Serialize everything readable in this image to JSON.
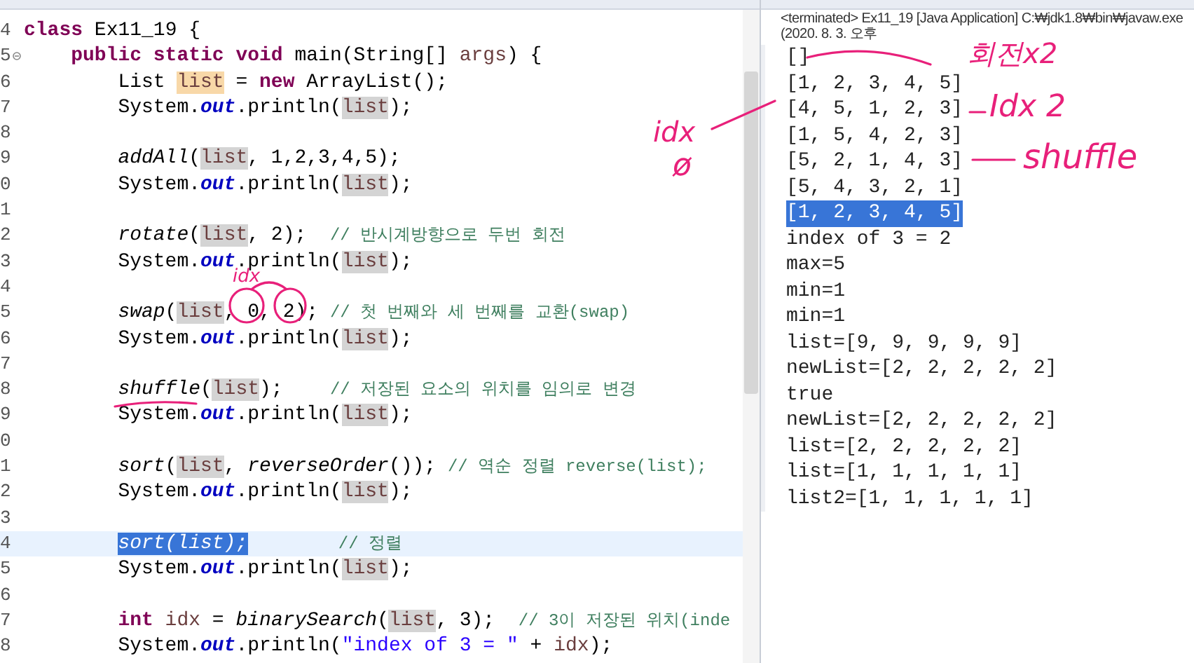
{
  "editor": {
    "lines": [
      {
        "number": "4",
        "current": false,
        "fold": false,
        "segments": [
          {
            "kind": "kw",
            "text": "class "
          },
          {
            "kind": "plain",
            "text": "Ex11_19 {"
          }
        ],
        "children": [
          {
            "number": "5",
            "current": false,
            "fold": true,
            "segments": [
              {
                "kind": "kw",
                "text": "public "
              },
              {
                "kind": "kw",
                "text": "static "
              },
              {
                "kind": "kw",
                "text": "void "
              },
              {
                "kind": "plain",
                "text": "main(String[] "
              },
              {
                "kind": "var",
                "text": "args"
              },
              {
                "kind": "plain",
                "text": ") {"
              }
            ],
            "children": [
              {
                "number": "6",
                "current": false,
                "fold": false,
                "segments": [
                  {
                    "kind": "plain",
                    "text": "List "
                  },
                  {
                    "kind": "write",
                    "text": "list"
                  },
                  {
                    "kind": "plain",
                    "text": " = "
                  },
                  {
                    "kind": "kw",
                    "text": "new"
                  },
                  {
                    "kind": "plain",
                    "text": " ArrayList();"
                  }
                ]
              },
              {
                "number": "7",
                "current": false,
                "fold": false,
                "segments": [
                  {
                    "kind": "plain",
                    "text": "System."
                  },
                  {
                    "kind": "field",
                    "text": "out"
                  },
                  {
                    "kind": "plain",
                    "text": ".println("
                  },
                  {
                    "kind": "occ",
                    "text": "list"
                  },
                  {
                    "kind": "plain",
                    "text": ");"
                  }
                ]
              },
              {
                "number": "8",
                "current": false,
                "fold": false
              },
              {
                "number": "9",
                "current": false,
                "fold": false,
                "segments": [
                  {
                    "kind": "method",
                    "text": "addAll"
                  },
                  {
                    "kind": "plain",
                    "text": "("
                  },
                  {
                    "kind": "occ",
                    "text": "list"
                  },
                  {
                    "kind": "plain",
                    "text": ", 1,2,3,4,5);"
                  }
                ]
              },
              {
                "number": "0",
                "current": false,
                "fold": false,
                "segments": [
                  {
                    "kind": "plain",
                    "text": "System."
                  },
                  {
                    "kind": "field",
                    "text": "out"
                  },
                  {
                    "kind": "plain",
                    "text": ".println("
                  },
                  {
                    "kind": "occ",
                    "text": "list"
                  },
                  {
                    "kind": "plain",
                    "text": ");"
                  }
                ]
              },
              {
                "number": "1",
                "current": false,
                "fold": false
              },
              {
                "number": "2",
                "current": false,
                "fold": false,
                "segments": [
                  {
                    "kind": "method",
                    "text": "rotate"
                  },
                  {
                    "kind": "plain",
                    "text": "("
                  },
                  {
                    "kind": "occ",
                    "text": "list"
                  },
                  {
                    "kind": "plain",
                    "text": ", 2);  "
                  },
                  {
                    "kind": "comment",
                    "text": "// 반시계방향으로 두번 회전"
                  }
                ]
              },
              {
                "number": "3",
                "current": false,
                "fold": false,
                "segments": [
                  {
                    "kind": "plain",
                    "text": "System."
                  },
                  {
                    "kind": "field",
                    "text": "out"
                  },
                  {
                    "kind": "plain",
                    "text": ".println("
                  },
                  {
                    "kind": "occ",
                    "text": "list"
                  },
                  {
                    "kind": "plain",
                    "text": ");"
                  }
                ]
              },
              {
                "number": "4",
                "current": false,
                "fold": false
              },
              {
                "number": "5",
                "current": false,
                "fold": false,
                "segments": [
                  {
                    "kind": "method",
                    "text": "swap"
                  },
                  {
                    "kind": "plain",
                    "text": "("
                  },
                  {
                    "kind": "occ",
                    "text": "list"
                  },
                  {
                    "kind": "plain",
                    "text": ", 0, 2); "
                  },
                  {
                    "kind": "comment",
                    "text": "// 첫 번째와 세 번째를 교환(swap)"
                  }
                ]
              },
              {
                "number": "6",
                "current": false,
                "fold": false,
                "segments": [
                  {
                    "kind": "plain",
                    "text": "System."
                  },
                  {
                    "kind": "field",
                    "text": "out"
                  },
                  {
                    "kind": "plain",
                    "text": ".println("
                  },
                  {
                    "kind": "occ",
                    "text": "list"
                  },
                  {
                    "kind": "plain",
                    "text": ");"
                  }
                ]
              },
              {
                "number": "7",
                "current": false,
                "fold": false
              },
              {
                "number": "8",
                "current": false,
                "fold": false,
                "segments": [
                  {
                    "kind": "method",
                    "text": "shuffle"
                  },
                  {
                    "kind": "plain",
                    "text": "("
                  },
                  {
                    "kind": "occ",
                    "text": "list"
                  },
                  {
                    "kind": "plain",
                    "text": ");    "
                  },
                  {
                    "kind": "comment",
                    "text": "// 저장된 요소의 위치를 임의로 변경"
                  }
                ]
              },
              {
                "number": "9",
                "current": false,
                "fold": false,
                "segments": [
                  {
                    "kind": "plain",
                    "text": "System."
                  },
                  {
                    "kind": "field",
                    "text": "out"
                  },
                  {
                    "kind": "plain",
                    "text": ".println("
                  },
                  {
                    "kind": "occ",
                    "text": "list"
                  },
                  {
                    "kind": "plain",
                    "text": ");"
                  }
                ]
              },
              {
                "number": "0",
                "current": false,
                "fold": false
              },
              {
                "number": "1",
                "current": false,
                "fold": false,
                "segments": [
                  {
                    "kind": "method",
                    "text": "sort"
                  },
                  {
                    "kind": "plain",
                    "text": "("
                  },
                  {
                    "kind": "occ",
                    "text": "list"
                  },
                  {
                    "kind": "plain",
                    "text": ", "
                  },
                  {
                    "kind": "method",
                    "text": "reverseOrder"
                  },
                  {
                    "kind": "plain",
                    "text": "()); "
                  },
                  {
                    "kind": "comment",
                    "text": "// 역순 정렬 reverse(list);"
                  }
                ]
              },
              {
                "number": "2",
                "current": false,
                "fold": false,
                "segments": [
                  {
                    "kind": "plain",
                    "text": "System."
                  },
                  {
                    "kind": "field",
                    "text": "out"
                  },
                  {
                    "kind": "plain",
                    "text": ".println("
                  },
                  {
                    "kind": "occ",
                    "text": "list"
                  },
                  {
                    "kind": "plain",
                    "text": ");"
                  }
                ]
              },
              {
                "number": "3",
                "current": false,
                "fold": false
              },
              {
                "number": "4",
                "current": true,
                "fold": false,
                "segments": [
                  {
                    "kind": "selection",
                    "text": "sort(list);"
                  },
                  {
                    "kind": "comment",
                    "text": "         // 정렬"
                  }
                ]
              },
              {
                "number": "5",
                "current": false,
                "fold": false,
                "segments": [
                  {
                    "kind": "plain",
                    "text": "System."
                  },
                  {
                    "kind": "field",
                    "text": "out"
                  },
                  {
                    "kind": "plain",
                    "text": ".println("
                  },
                  {
                    "kind": "occ",
                    "text": "list"
                  },
                  {
                    "kind": "plain",
                    "text": ");"
                  }
                ]
              },
              {
                "number": "6",
                "current": false,
                "fold": false
              },
              {
                "number": "7",
                "current": false,
                "fold": false,
                "segments": [
                  {
                    "kind": "kw",
                    "text": "int "
                  },
                  {
                    "kind": "var",
                    "text": "idx"
                  },
                  {
                    "kind": "plain",
                    "text": " = "
                  },
                  {
                    "kind": "method",
                    "text": "binarySearch"
                  },
                  {
                    "kind": "plain",
                    "text": "("
                  },
                  {
                    "kind": "occ",
                    "text": "list"
                  },
                  {
                    "kind": "plain",
                    "text": ", 3);  "
                  },
                  {
                    "kind": "comment",
                    "text": "// 3이 저장된 위치(inde"
                  }
                ]
              },
              {
                "number": "8",
                "current": false,
                "fold": false,
                "segments": [
                  {
                    "kind": "plain",
                    "text": "System."
                  },
                  {
                    "kind": "field",
                    "text": "out"
                  },
                  {
                    "kind": "plain",
                    "text": ".println("
                  },
                  {
                    "kind": "string",
                    "text": "\"index of 3 = \""
                  },
                  {
                    "kind": "plain",
                    "text": " + "
                  },
                  {
                    "kind": "var",
                    "text": "idx"
                  },
                  {
                    "kind": "plain",
                    "text": ");"
                  }
                ]
              }
            ]
          }
        ]
      }
    ]
  },
  "console": {
    "header": "<terminated> Ex11_19 [Java Application] C:₩jdk1.8₩bin₩javaw.exe (2020. 8. 3. 오후",
    "lines": [
      {
        "text": "[]",
        "selected": false
      },
      {
        "text": "[1, 2, 3, 4, 5]",
        "selected": false
      },
      {
        "text": "[4, 5, 1, 2, 3]",
        "selected": false
      },
      {
        "text": "[1, 5, 4, 2, 3]",
        "selected": false
      },
      {
        "text": "[5, 2, 1, 4, 3]",
        "selected": false
      },
      {
        "text": "[5, 4, 3, 2, 1]",
        "selected": false
      },
      {
        "text": "[1, 2, 3, 4, 5]",
        "selected": true
      },
      {
        "text": "index of 3 = 2",
        "selected": false
      },
      {
        "text": "max=5",
        "selected": false
      },
      {
        "text": "min=1",
        "selected": false
      },
      {
        "text": "min=1",
        "selected": false
      },
      {
        "text": "list=[9, 9, 9, 9, 9]",
        "selected": false
      },
      {
        "text": "newList=[2, 2, 2, 2, 2]",
        "selected": false
      },
      {
        "text": "true",
        "selected": false
      },
      {
        "text": "newList=[2, 2, 2, 2, 2]",
        "selected": false
      },
      {
        "text": "list=[2, 2, 2, 2, 2]",
        "selected": false
      },
      {
        "text": "list=[1, 1, 1, 1, 1]",
        "selected": false
      },
      {
        "text": "list2=[1, 1, 1, 1, 1]",
        "selected": false
      }
    ]
  },
  "annotations": [
    "idx",
    "idx",
    "ø",
    "회전x2",
    "Idx 2",
    "shuffle"
  ]
}
